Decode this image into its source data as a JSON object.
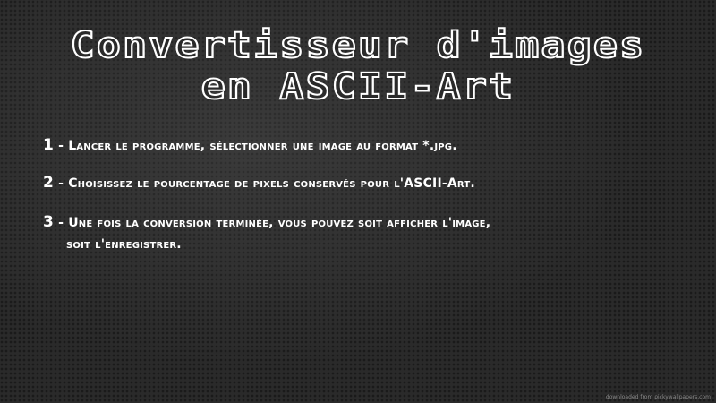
{
  "title": {
    "line1": "Convertisseur d'images",
    "line2": "en ASCII-Art"
  },
  "steps": [
    {
      "num": "1",
      "text": " - Lancer le programme, sélectionner une image au format *.jpg."
    },
    {
      "num": "2",
      "text": " - Choisissez le pourcentage de pixels conservés pour l'ASCII-Art."
    },
    {
      "num": "3",
      "text": " - Une fois la conversion terminée, vous pouvez soit afficher l'image,",
      "cont": "soit l'enregistrer."
    }
  ],
  "credit": "downloaded from pickywallpapers.com"
}
